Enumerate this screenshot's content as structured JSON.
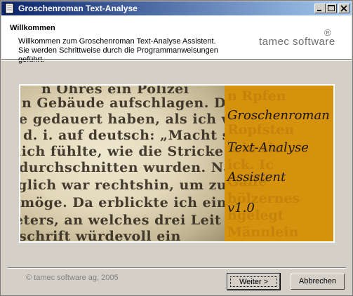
{
  "window": {
    "title": "Groschenroman Text-Analyse",
    "controls": [
      "minimize-icon",
      "maximize-icon",
      "close-icon"
    ]
  },
  "header": {
    "title": "Willkommen",
    "description": "Willkommen zum Groschenroman Text-Analyse Assistent. Sie werden Schrittweise durch die Programmanweisungen geführt.",
    "brand": "tamec software",
    "registered": "®"
  },
  "banner": {
    "lines": [
      "Groschenroman",
      "Text-Analyse",
      "Assistent",
      "v1.0"
    ],
    "panel_color": "#d4920d"
  },
  "footer": {
    "copyright": "© tamec software ag, 2005",
    "next_label": "Weiter >",
    "cancel_label": "Abbrechen"
  }
}
